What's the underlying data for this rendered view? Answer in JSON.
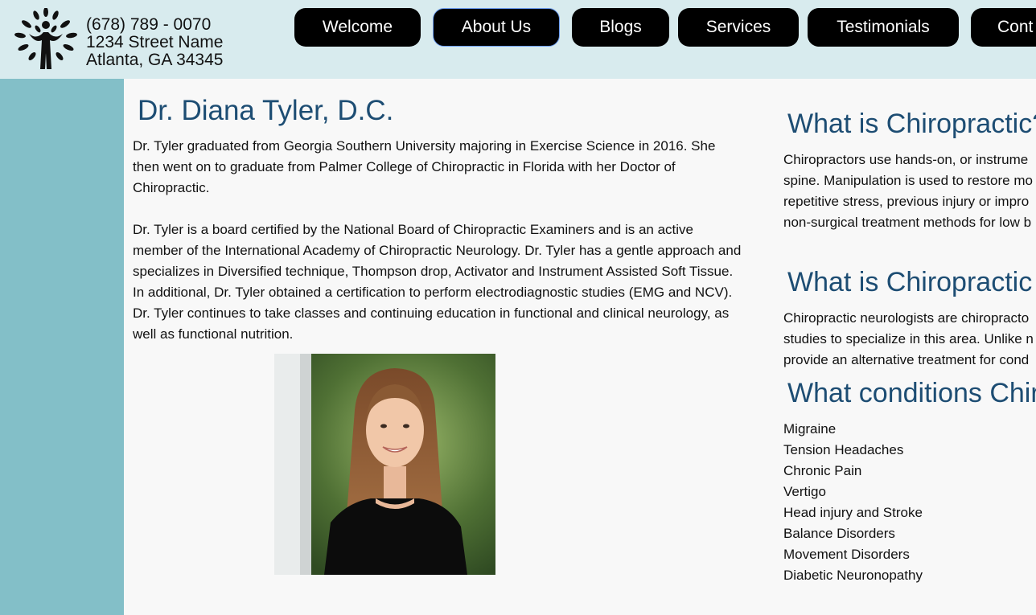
{
  "header": {
    "phone": "(678) 789 - 0070",
    "street": "1234 Street Name",
    "city": "Atlanta, GA 34345"
  },
  "nav": {
    "items": [
      {
        "label": "Welcome"
      },
      {
        "label": "About Us",
        "active": true
      },
      {
        "label": "Blogs"
      },
      {
        "label": "Services"
      },
      {
        "label": "Testimonials"
      },
      {
        "label": "Cont"
      }
    ]
  },
  "doctor": {
    "title": "Dr. Diana Tyler, D.C.",
    "bio_1": "Dr. Tyler graduated from Georgia Southern University majoring in Exercise Science in 2016. She then went on to graduate from Palmer College of Chiropractic in Florida with her Doctor of Chiropractic.",
    "bio_2": "Dr. Tyler is a board certified by the National Board of Chiropractic Examiners and is an active member of the International Academy of Chiropractic Neurology. Dr. Tyler has a gentle approach and specializes in Diversified technique, Thompson drop, Activator and Instrument Assisted Soft Tissue. In additional, Dr. Tyler obtained a certification to perform electrodiagnostic studies (EMG and NCV). Dr. Tyler continues to take classes and continuing education in functional and clinical neurology, as well as functional nutrition."
  },
  "side": {
    "h1": "What is Chiropractic?",
    "p1": [
      "Chiropractors use hands-on, or instrume",
      "spine. Manipulation is used to restore mo",
      "repetitive stress, previous injury or impro",
      "non-surgical treatment methods for low b"
    ],
    "h2": "What is Chiropractic N",
    "p2": [
      "Chiropractic neurologists are chiropracto",
      "studies to specialize in this area. Unlike n",
      "provide an alternative treatment for cond"
    ],
    "h3": "What conditions Chiro",
    "conditions": [
      "Migraine",
      "Tension Headaches",
      "Chronic Pain",
      "Vertigo",
      "Head injury and Stroke",
      "Balance Disorders",
      "Movement Disorders",
      "Diabetic Neuronopathy"
    ]
  },
  "colors": {
    "header_bg": "#d8ebee",
    "sidebar_bg": "#83bfc8",
    "heading": "#1d4d73",
    "nav_bg": "#000000"
  }
}
